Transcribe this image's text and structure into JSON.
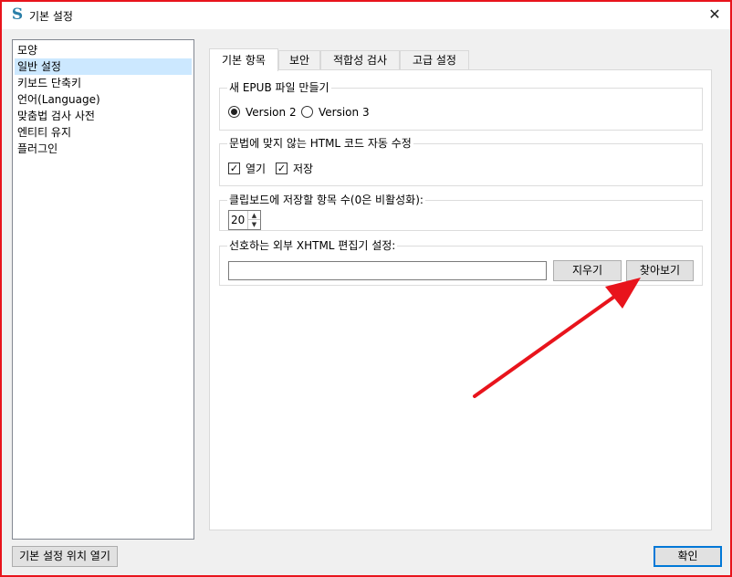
{
  "window": {
    "title": "기본 설정"
  },
  "sidebar": {
    "items": [
      {
        "label": "모양"
      },
      {
        "label": "일반 설정"
      },
      {
        "label": "키보드 단축키"
      },
      {
        "label": "언어(Language)"
      },
      {
        "label": "맞춤법 검사 사전"
      },
      {
        "label": "엔티티 유지"
      },
      {
        "label": "플러그인"
      }
    ],
    "selected_index": 1
  },
  "tabs": [
    {
      "label": "기본 항목"
    },
    {
      "label": "보안"
    },
    {
      "label": "적합성 검사"
    },
    {
      "label": "고급 설정"
    }
  ],
  "epub": {
    "title": "새 EPUB 파일 만들기",
    "option_v2": "Version 2",
    "option_v3": "Version 3"
  },
  "autofix": {
    "title": "문법에 맞지 않는 HTML 코드 자동 수정",
    "open_label": "열기",
    "save_label": "저장"
  },
  "clipboard": {
    "title": "클립보드에 저장할 항목 수(0은 비활성화):",
    "value": "20"
  },
  "editor": {
    "title": "선호하는 외부 XHTML 편집기 설정:",
    "path_value": "",
    "clear_label": "지우기",
    "browse_label": "찾아보기"
  },
  "footer": {
    "open_location_label": "기본 설정 위치 열기",
    "ok_label": "확인"
  },
  "colors": {
    "border_highlight": "#e8141c",
    "arrow": "#e8141c",
    "selection": "#cce8ff",
    "default_button_border": "#0078d7"
  },
  "icons": {
    "app": "sigil-logo-icon",
    "close": "close-icon",
    "spin_up": "chevron-up-icon",
    "spin_down": "chevron-down-icon",
    "annotation": "red-arrow-annotation"
  },
  "glyphs": {
    "app": "S",
    "close": "✕",
    "check": "✓",
    "spin_up": "▲",
    "spin_down": "▼"
  }
}
